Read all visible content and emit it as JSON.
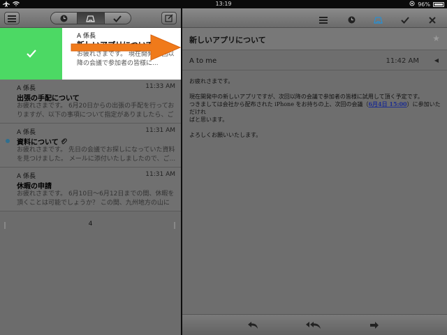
{
  "status_bar": {
    "time": "13:19",
    "battery": "96%"
  },
  "left_panel": {
    "toolbar": {
      "menu_icon": "menu-icon",
      "clock_icon": "clock-icon",
      "inbox_icon": "inbox-icon",
      "check_icon": "check-icon",
      "compose_icon": "compose-icon"
    },
    "swipe_item": {
      "sender": "A 係長",
      "subject": "新しいアプリについて",
      "preview": "お疲れさまです。 現在開発... 回以降の会議で参加者の皆様に..."
    },
    "items": [
      {
        "sender": "A 係長",
        "time": "11:33 AM",
        "subject": "出張の手配について",
        "preview": "お疲れさまです。 6月20日からの出張の手配を行っておりますが、以下の事項について指定がありましたら、ご連..."
      },
      {
        "sender": "A 係長",
        "time": "11:31 AM",
        "subject": "資料について",
        "preview": "お疲れさまです。 先日の会議でお探しになっていた資料を見つけました。 メールに添付いたしましたので、ご..."
      },
      {
        "sender": "A 係長",
        "time": "11:31 AM",
        "subject": "休暇の申請",
        "preview": "お疲れさまです。 6月10日〜6月12日までの間、休暇を頂くことは可能でしょうか？ この間、九州地方の山に登..."
      }
    ],
    "pager": {
      "page": "4"
    }
  },
  "right_panel": {
    "toolbar": {
      "menu_icon": "menu-icon",
      "clock_icon": "clock-icon",
      "inbox_icon": "inbox-icon",
      "check_icon": "check-icon",
      "close_icon": "close-icon"
    },
    "subject": "新しいアプリについて",
    "recipient": "A to me",
    "time": "11:42 AM",
    "body": {
      "greeting": "お疲れさまです。",
      "line1": "現在開発中の新しいアプリですが、次回以降の会議で参加者の皆様に試用して頂く予定です。",
      "line2_pre": "つきましては会社から配布された iPhone をお持ちの上、次回の会議（",
      "line2_link": "6月4日 15:00",
      "line2_post": "）に参加いただけれ",
      "line3": "ばと思います。",
      "closing": "よろしくお願いいたします。"
    },
    "bottom_bar": {
      "reply_icon": "reply-icon",
      "reply_all_icon": "reply-all-icon",
      "forward_icon": "forward-icon"
    }
  },
  "colors": {
    "swipe_green": "#4cd964",
    "arrow_orange": "#f07a1a",
    "unread_blue": "#2f6f8f"
  }
}
